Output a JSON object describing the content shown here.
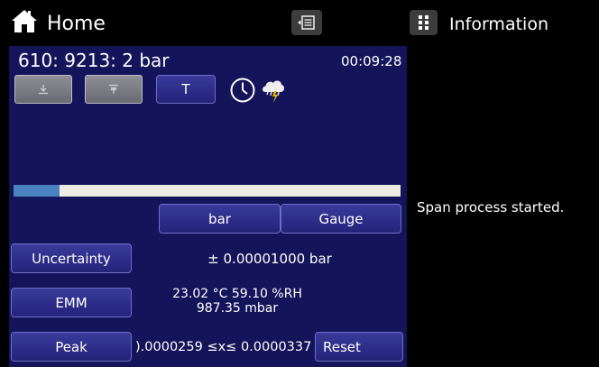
{
  "header": {
    "home_label": "Home",
    "info_label": "Information"
  },
  "panel": {
    "channel_title": "610: 9213:  2 bar",
    "timer": "00:09:28",
    "tare_label": "T",
    "progress_percent": 12,
    "unit_button": "bar",
    "mode_button": "Gauge",
    "uncertainty": {
      "label": "Uncertainty",
      "value": "± 0.00001000   bar"
    },
    "emm": {
      "label": "EMM",
      "line1": "23.02 °C   59.10 %RH",
      "line2": "987.35 mbar"
    },
    "peak": {
      "label": "Peak",
      "value": ").0000259 ≤x≤ 0.0000337",
      "reset_label": "Reset"
    }
  },
  "status_text": "Span process started.",
  "colors": {
    "panel_bg": "#14145a",
    "progress_fill": "#4a84c0",
    "progress_track": "#ecece4"
  }
}
